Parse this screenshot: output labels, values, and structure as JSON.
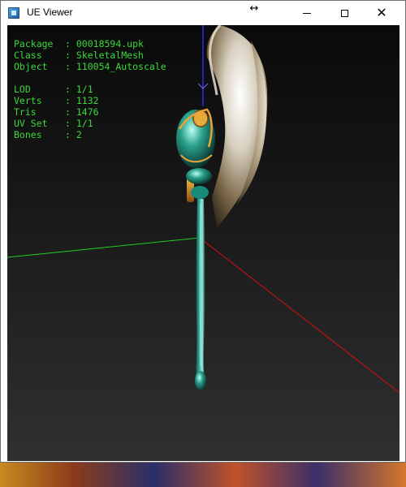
{
  "window": {
    "title": "UE Viewer"
  },
  "titlebar": {
    "icons": {
      "app": "app-icon",
      "move": "move-cursor-icon",
      "minimize": "minimize-icon",
      "maximize": "maximize-icon",
      "close": "close-icon"
    },
    "move_glyph": "↔",
    "close_glyph": "✕"
  },
  "info": {
    "package_key": "Package",
    "package_value": "00018594.upk",
    "class_key": "Class",
    "class_value": "SkeletalMesh",
    "object_key": "Object",
    "object_value": "110054_Autoscale",
    "lod_key": "LOD",
    "lod_value": "1/1",
    "verts_key": "Verts",
    "verts_value": "1132",
    "tris_key": "Tris",
    "tris_value": "1476",
    "uvset_key": "UV Set",
    "uvset_value": "1/1",
    "bones_key": "Bones",
    "bones_value": "2",
    "separator": ":"
  },
  "colors": {
    "info_text": "#3ad83a",
    "axis_x": "#d01010",
    "axis_y": "#22cc22",
    "axis_z": "#2a2aee"
  },
  "background": {
    "left_glyphs": [
      "t",
      "c",
      "t",
      "t",
      "t",
      "c",
      "t",
      "t",
      "t",
      "c",
      "t",
      "c",
      "t",
      "t",
      "c",
      "t",
      "t",
      "c",
      "t",
      "t",
      "c",
      "t",
      "t",
      "c",
      "t",
      "t",
      "t",
      "c",
      "t",
      "c",
      "t",
      "c",
      "t",
      "t",
      "c",
      "t",
      "c",
      "t",
      "t",
      "t",
      "c"
    ],
    "right_glyphs": [
      "t",
      "c",
      "c",
      "v",
      "O",
      "t",
      "t",
      "c",
      "t",
      "t",
      "t",
      "c",
      "t",
      "t",
      "c",
      "t",
      "t",
      "t",
      "c",
      "t",
      "c",
      "t",
      "t",
      "s",
      "t",
      "t",
      "t",
      "C",
      "t",
      "c",
      "t",
      "t",
      "c",
      "t",
      "t",
      "s",
      "t",
      "c",
      "t",
      "t",
      "t"
    ]
  }
}
